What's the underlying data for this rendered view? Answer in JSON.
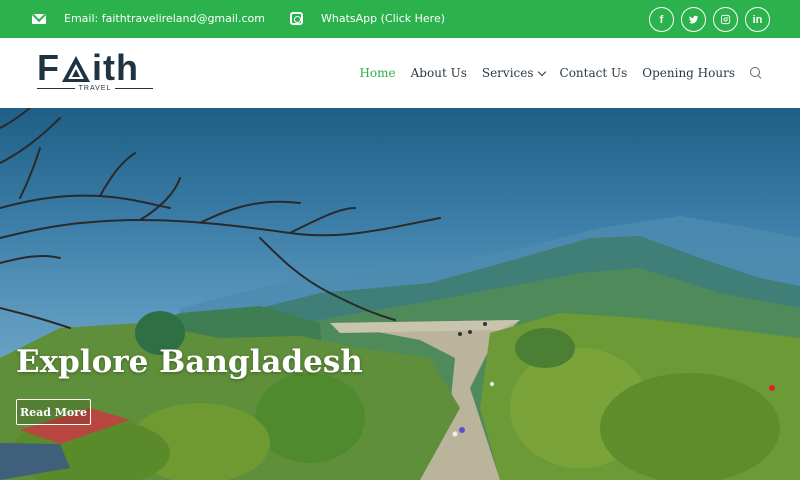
{
  "topbar": {
    "email_text": "Email: faithtravelireland@gmail.com",
    "whatsapp_text": "WhatsApp (Click Here)",
    "socials": [
      {
        "name": "facebook-icon",
        "glyph": "f"
      },
      {
        "name": "twitter-icon",
        "glyph": ""
      },
      {
        "name": "instagram-icon",
        "glyph": ""
      },
      {
        "name": "linkedin-icon",
        "glyph": "in"
      }
    ],
    "color": "#2bb24c"
  },
  "logo": {
    "word_start": "F",
    "word_end": "ith",
    "sub": "TRAVEL"
  },
  "nav": {
    "items": [
      {
        "label": "Home",
        "active": true
      },
      {
        "label": "About Us"
      },
      {
        "label": "Services",
        "dropdown": true
      },
      {
        "label": "Contact Us"
      },
      {
        "label": "Opening Hours"
      }
    ]
  },
  "hero": {
    "title": "Explore Bangladesh",
    "button": "Read More"
  }
}
